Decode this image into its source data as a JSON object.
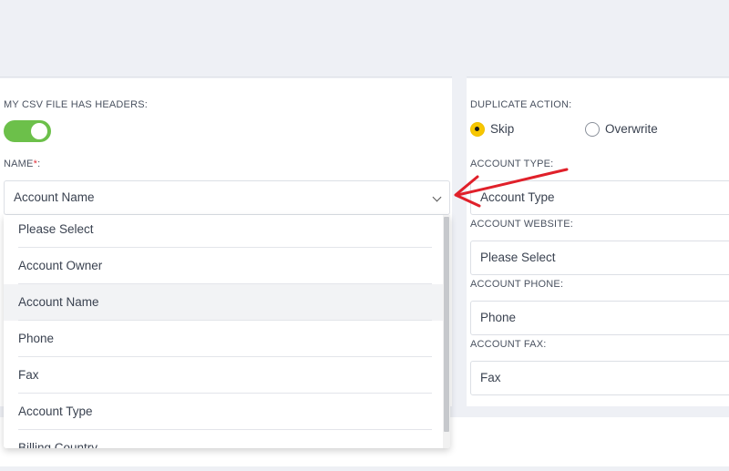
{
  "left": {
    "headers_label": "MY CSV FILE HAS HEADERS:",
    "headers_toggle_on": true,
    "name_label": "NAME",
    "name_required_mark": "*",
    "name_colon": ":",
    "name_select_value": "Account Name"
  },
  "right": {
    "duplicate_label": "DUPLICATE ACTION:",
    "radio_skip": "Skip",
    "radio_overwrite": "Overwrite",
    "selected_action": "Skip",
    "account_type_label": "ACCOUNT TYPE:",
    "account_type_value": "Account Type",
    "account_website_label": "ACCOUNT WEBSITE:",
    "account_website_value": "Please Select",
    "account_phone_label": "ACCOUNT PHONE:",
    "account_phone_value": "Phone",
    "account_fax_label": "ACCOUNT FAX:",
    "account_fax_value": "Fax"
  },
  "dropdown": {
    "options": [
      "Please Select",
      "Account Owner",
      "Account Name",
      "Phone",
      "Fax",
      "Account Type",
      "Billing Country"
    ],
    "highlighted": "Account Name"
  },
  "colors": {
    "toggle_on": "#6cc04a",
    "radio_selected": "#f7c600",
    "required": "#e0323c",
    "annotation_arrow": "#e0202a"
  },
  "icons": {
    "select_chevron": "chevron-down-icon",
    "annotation": "red-arrow-annotation"
  }
}
